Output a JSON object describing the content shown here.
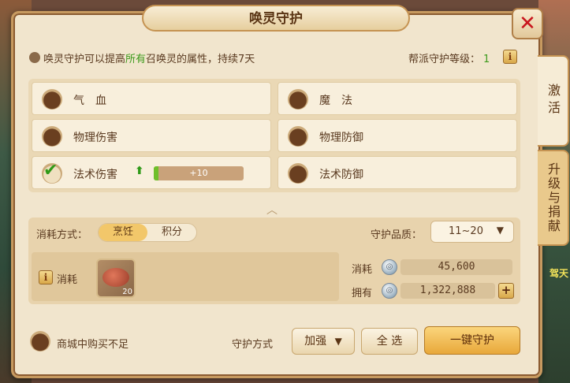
{
  "window": {
    "title": "唤灵守护",
    "close_icon": "close-icon"
  },
  "description": {
    "prefix": "唤灵守护可以提高",
    "highlight": "所有",
    "suffix": "召唤灵的属性，持续7天"
  },
  "guild_level": {
    "label": "帮派守护等级：",
    "value": "1"
  },
  "attributes": [
    {
      "label": "气　血",
      "checked": false
    },
    {
      "label": "魔　法",
      "checked": false
    },
    {
      "label": "物理伤害",
      "checked": false
    },
    {
      "label": "物理防御",
      "checked": false
    },
    {
      "label": "法术伤害",
      "checked": true,
      "bonus_text": "+10",
      "progress_fraction": 0.05
    },
    {
      "label": "法术防御",
      "checked": false
    }
  ],
  "cost": {
    "mode_label": "消耗方式：",
    "mode_options": [
      "烹饪",
      "积分"
    ],
    "mode_selected": "烹饪",
    "quality_label": "守护品质：",
    "quality_value": "11~20",
    "consume_label": "消耗",
    "item_count": "20",
    "consume_amount_label": "消耗",
    "consume_amount": "45,600",
    "owned_label": "拥有",
    "owned_amount": "1,322,888"
  },
  "footer": {
    "shop_label": "商城中购买不足",
    "guard_mode_label": "守护方式",
    "guard_mode_value": "加强",
    "select_all_label": "全 选",
    "one_click_label": "一键守护"
  },
  "tabs": [
    {
      "label": "激活",
      "active": true
    },
    {
      "label": "升级与捐献",
      "active": false
    }
  ],
  "background": {
    "right_text": "驾天"
  }
}
